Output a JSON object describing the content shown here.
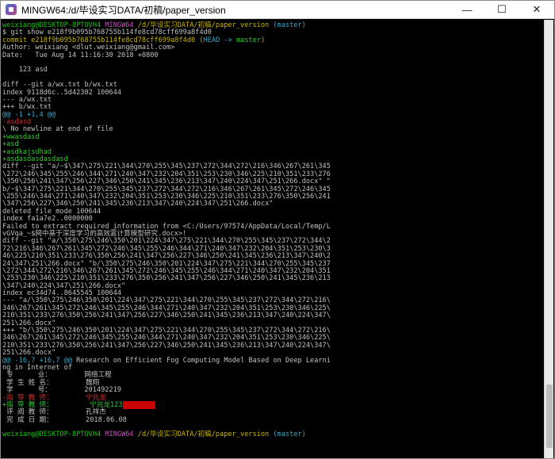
{
  "window": {
    "title": "MINGW64:/d/毕设实习DATA/初稿/paper_version",
    "minimize": "—",
    "maximize": "☐",
    "close": "✕"
  },
  "prompt1": {
    "user": "weixiang@DESKTOP-8PTOVH4",
    "env": "MINGW64",
    "path": "/d/毕设实习DATA/初稿/paper_version",
    "branch": "(master)"
  },
  "command": "$ git show e218f9b095b768755b114fe8cd78cff699a8f4d0",
  "commit": {
    "line": "commit e218f9b095b768755b114fe8cd78cff699a8f4d0",
    "refs_open": " (",
    "head": "HEAD -> ",
    "branch": "master",
    "refs_close": ")",
    "author": "Author: weixiang <dlut.weixiang@gmail.com>",
    "date": "Date:   Tue Aug 14 11:16:30 2018 +0800",
    "message": "    123 asd"
  },
  "lines": [
    "",
    "diff --git a/wx.txt b/wx.txt",
    "index 9118d6c..5d42302 100644",
    "--- a/wx.txt",
    "+++ b/wx.txt"
  ],
  "hunk1": "@@ -1 +1,4 @@",
  "removed1": "-asdasd",
  "nonewline": "\\ No newline at end of file",
  "added1": [
    "+wwasdasd",
    "+asd",
    "+asdkajsdhad",
    "+asdasdasdasdasd"
  ],
  "diff2": [
    "diff --git \"a/~$\\347\\275\\221\\344\\270\\255\\345\\237\\272\\344\\272\\216\\346\\267\\261\\345",
    "\\272\\246\\345\\255\\246\\344\\271\\240\\347\\232\\204\\351\\253\\230\\346\\225\\210\\351\\233\\276",
    "\\350\\256\\241\\347\\256\\227\\346\\250\\241\\345\\236\\213\\347\\240\\224\\347\\251\\266.docx\" \"",
    "b/~$\\347\\275\\221\\344\\270\\255\\345\\237\\272\\344\\272\\216\\346\\267\\261\\345\\272\\246\\345",
    "\\255\\246\\344\\271\\240\\347\\232\\204\\351\\253\\230\\346\\225\\210\\351\\233\\276\\350\\256\\241",
    "\\347\\256\\227\\346\\250\\241\\345\\236\\213\\347\\240\\224\\347\\251\\266.docx\"",
    "deleted file mode 100644",
    "index fa1a7e2..0000000",
    "Failed to extract required information from <C:/Users/97574/AppData/Local/Temp/L",
    "vGVqa_~$网中基于深度学习的高效雾计算模型研究.docx>!",
    "diff --git \"a/\\350\\275\\246\\350\\201\\224\\347\\275\\221\\344\\270\\255\\345\\237\\272\\344\\2",
    "72\\216\\346\\267\\261\\345\\272\\246\\345\\255\\246\\344\\271\\240\\347\\232\\204\\351\\253\\230\\3",
    "46\\225\\210\\351\\233\\276\\350\\256\\241\\347\\256\\227\\346\\250\\241\\345\\236\\213\\347\\240\\2",
    "24\\347\\251\\266.docx\" \"b/\\350\\275\\246\\350\\201\\224\\347\\275\\221\\344\\270\\255\\345\\237",
    "\\272\\344\\272\\216\\346\\267\\261\\345\\272\\246\\345\\255\\246\\344\\271\\240\\347\\232\\204\\351",
    "\\253\\230\\346\\225\\210\\351\\233\\276\\350\\256\\241\\347\\256\\227\\346\\250\\241\\345\\236\\213",
    "\\347\\240\\224\\347\\251\\266.docx\"",
    "index ec34d74..8645545 100644",
    "--- \"a/\\350\\275\\246\\350\\201\\224\\347\\275\\221\\344\\270\\255\\345\\237\\272\\344\\272\\216\\",
    "346\\267\\261\\345\\272\\246\\345\\255\\246\\344\\271\\240\\347\\232\\204\\351\\253\\230\\346\\225\\",
    "210\\351\\233\\276\\350\\256\\241\\347\\256\\227\\346\\250\\241\\345\\236\\213\\347\\240\\224\\347\\",
    "251\\266.docx\"",
    "+++ \"b/\\350\\275\\246\\350\\201\\224\\347\\275\\221\\344\\270\\255\\345\\237\\272\\344\\272\\216\\",
    "346\\267\\261\\345\\272\\246\\345\\255\\246\\344\\271\\240\\347\\232\\204\\351\\253\\230\\346\\225\\",
    "210\\351\\233\\276\\350\\256\\241\\347\\256\\227\\346\\250\\241\\345\\236\\213\\347\\240\\224\\347\\",
    "251\\266.docx\""
  ],
  "hunk2": {
    "marker": "@@ -16,7 +16,7 @@",
    "context": " Research on Efficient Fog Computing Model Based on Deep Learni",
    "wrap": "ng in Internet of"
  },
  "doc_lines": {
    "major": " 专      业：        网络工程",
    "name": " 学 生 姓 名：        魏翔",
    "student_id": " 学      号：        201492219",
    "removed_advisor": "-指 导 教 师：        宁兆龙",
    "added_advisor_prefix": "+指 导 教 师：         宁兆龙123",
    "added_advisor_redacted": "        ",
    "reviewer": " 评 阅 教 师：        孔祥杰",
    "date": " 完 成 日 期：        2018.06.08"
  },
  "prompt2": {
    "user": "weixiang@DESKTOP-8PTOVH4",
    "env": "MINGW64",
    "path": "/d/毕设实习DATA/初稿/paper_version",
    "branch": "(master)"
  },
  "colors": {
    "prompt_user": "#16c60c",
    "prompt_env": "#c850c0",
    "prompt_path": "#c8b400",
    "branch": "#3aa6c8",
    "removed": "#d03030",
    "added": "#2dcd2d"
  }
}
